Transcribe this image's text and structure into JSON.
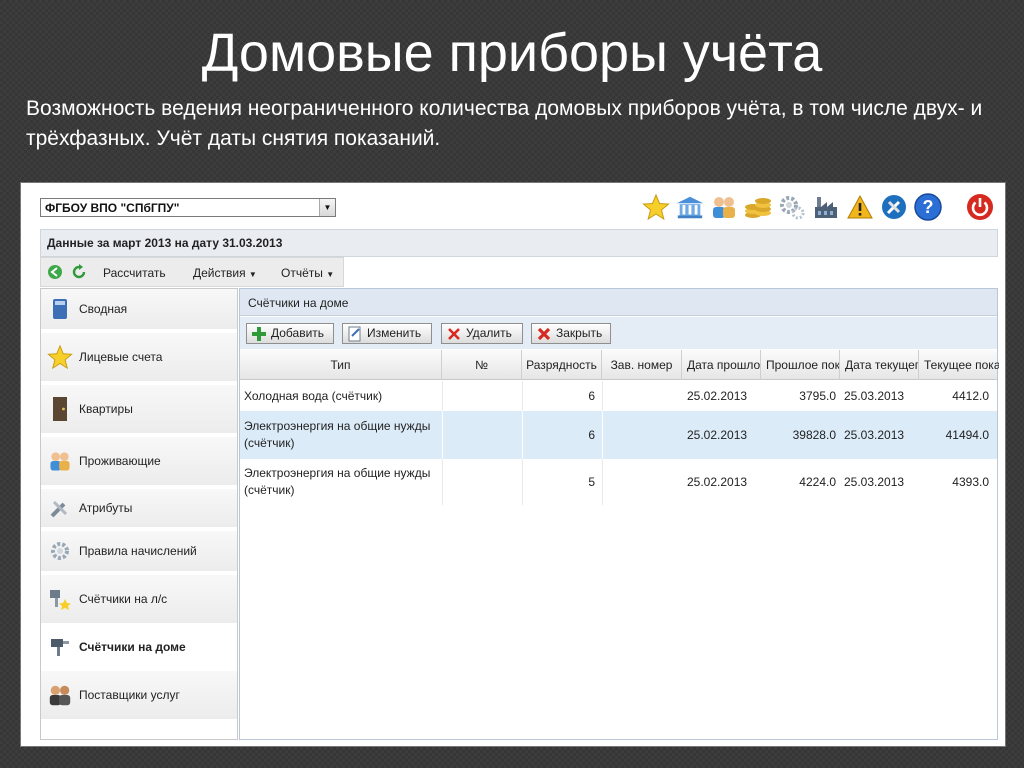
{
  "slide": {
    "title": "Домовые приборы учёта",
    "subtitle": "Возможность ведения неограниченного количества домовых приборов учёта, в том числе двух- и трёхфазных. Учёт даты снятия показаний."
  },
  "app": {
    "org_select": {
      "value": "ФГБОУ ВПО \"СПбГПУ\""
    },
    "header_icons": [
      "star-icon",
      "bank-icon",
      "people-icon",
      "coins-icon",
      "gears-icon",
      "factory-icon",
      "warning-icon",
      "tools-icon",
      "help-icon",
      "power-icon"
    ],
    "period": "Данные за март 2013 на дату 31.03.2013",
    "toolbar": {
      "calculate": "Рассчитать",
      "actions": "Действия",
      "reports": "Отчёты"
    },
    "sidebar": {
      "items": [
        {
          "label": "Сводная",
          "icon": "book-icon"
        },
        {
          "label": "Лицевые счета",
          "icon": "star-icon"
        },
        {
          "label": "Квартиры",
          "icon": "door-icon"
        },
        {
          "label": "Проживающие",
          "icon": "people-icon"
        },
        {
          "label": "Атрибуты",
          "icon": "tools-icon"
        },
        {
          "label": "Правила начислений",
          "icon": "gear-icon"
        },
        {
          "label": "Счётчики на л/с",
          "icon": "meter-star-icon"
        },
        {
          "label": "Счётчики на доме",
          "icon": "meter-icon",
          "active": true
        },
        {
          "label": "Поставщики услуг",
          "icon": "suppliers-icon"
        }
      ]
    },
    "panel": {
      "title": "Счётчики на доме",
      "buttons": {
        "add": "Добавить",
        "edit": "Изменить",
        "delete": "Удалить",
        "close": "Закрыть"
      },
      "columns": [
        "Тип",
        "№",
        "Разрядность",
        "Зав. номер",
        "Дата прошло",
        "Прошлое пок",
        "Дата текущег",
        "Текущее пока"
      ],
      "rows": [
        {
          "type": "Холодная вода (счётчик)",
          "num": "",
          "digits": "6",
          "serial": "",
          "prev_date": "25.02.2013",
          "prev_value": "3795.0",
          "cur_date": "25.03.2013",
          "cur_value": "4412.0"
        },
        {
          "type": "Электроэнергия на общие нужды (счётчик)",
          "num": "",
          "digits": "6",
          "serial": "",
          "prev_date": "25.02.2013",
          "prev_value": "39828.0",
          "cur_date": "25.03.2013",
          "cur_value": "41494.0"
        },
        {
          "type": "Электроэнергия на общие нужды (счётчик)",
          "num": "",
          "digits": "5",
          "serial": "",
          "prev_date": "25.02.2013",
          "prev_value": "4224.0",
          "cur_date": "25.03.2013",
          "cur_value": "4393.0"
        }
      ]
    },
    "colors": {
      "accent": "#2b6fd6",
      "selected_row": "#dcebf8",
      "panel_header": "#dfe8f2"
    }
  }
}
